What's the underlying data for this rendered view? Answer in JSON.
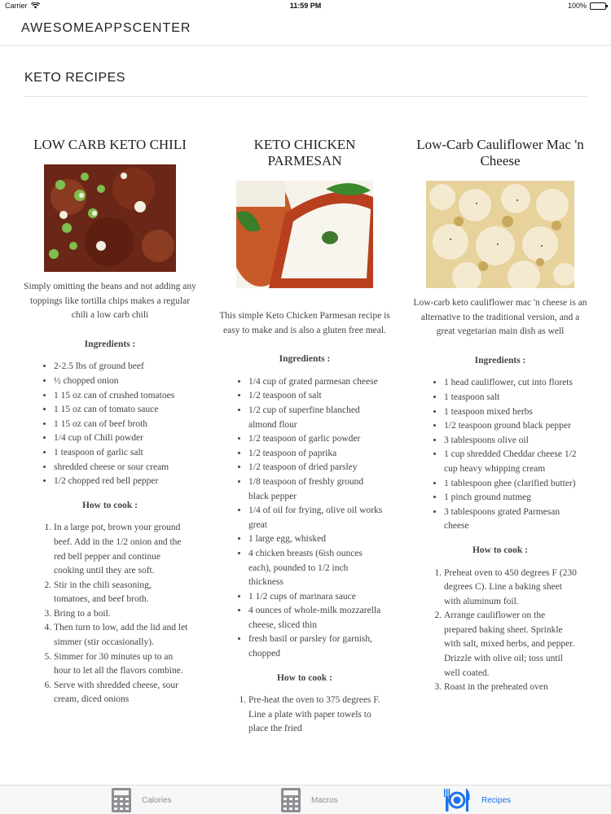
{
  "status_bar": {
    "carrier": "Carrier",
    "time": "11:59 PM",
    "battery": "100%"
  },
  "app": {
    "title": "AWESOMEAPPSCENTER"
  },
  "page": {
    "title": "KETO RECIPES"
  },
  "recipes": [
    {
      "title": "LOW CARB KETO CHILI",
      "description": "Simply omitting the beans and not adding any toppings like tortilla chips makes a regular chili a low carb chili",
      "ingredients_heading": "Ingredients :",
      "ingredients": [
        "2-2.5  lbs of ground beef",
        "½   chopped onion",
        "1  15 oz can of crushed tomatoes",
        "1  15 oz can of tomato sauce",
        "1  15 oz can of beef broth",
        "1/4  cup of Chili powder",
        "1  teaspoon of garlic salt",
        "shredded cheese or sour cream",
        "1/2  chopped red bell pepper"
      ],
      "steps_heading": "How to cook :",
      "steps": [
        "In  a large pot,  brown your ground beef. Add in the 1/2 onion and the  red bell pepper and continue cooking until they are soft.",
        "Stir  in the chili seasoning, tomatoes, and beef broth.",
        "Bring  to a boil.",
        "Then turn to low, add the lid and let simmer (stir occasionally).",
        "Simmer  for 30 minutes up to an hour to let all the flavors combine.",
        "Serve  with shredded cheese, sour cream, diced onions"
      ]
    },
    {
      "title": "KETO CHICKEN PARMESAN",
      "description": "This simple Keto Chicken Parmesan recipe is easy to make and is also a gluten free meal.",
      "ingredients_heading": "Ingredients :",
      "ingredients": [
        "1/4 cup of grated parmesan    cheese",
        "1/2 teaspoon of salt",
        "1/2 cup of superfine blanched    almond flour",
        "1/2 teaspoon of garlic powder",
        "1/2 teaspoon of paprika",
        "1/2 teaspoon of dried parsley",
        "1/8 teaspoon of freshly    ground black pepper",
        "1/4 of oil for frying, olive     oil works great",
        "1 large egg, whisked",
        "4 chicken breasts (6ish    ounces each), pounded to 1/2 inch thickness",
        "1 1/2 cups of marinara sauce",
        "4 ounces of whole-milk    mozzarella cheese, sliced thin",
        "fresh basil or parsley for    garnish, chopped"
      ],
      "steps_heading": "How to cook :",
      "steps": [
        "Pre-heat the oven to 375    degrees F. Line a plate with paper towels to place the fried"
      ]
    },
    {
      "title": "Low-Carb Cauliflower Mac 'n Cheese",
      "description": "Low-carb keto cauliflower mac 'n cheese is an alternative  to the traditional version, and a great vegetarian main dish as well",
      "ingredients_heading": "Ingredients :",
      "ingredients": [
        "1 head cauliflower, cut into florets",
        "1 teaspoon salt",
        "1 teaspoon mixed herbs",
        "1/2 teaspoon ground black pepper",
        "3 tablespoons olive oil",
        "1 cup shredded Cheddar cheese  1/2 cup    heavy whipping cream",
        "1 tablespoon ghee (clarified butter)",
        "1 pinch ground nutmeg",
        "3 tablespoons grated Parmesan cheese"
      ],
      "steps_heading": "How to cook :",
      "steps": [
        "Preheat oven to 450 degrees F (230 degrees   C). Line a baking sheet with aluminum foil.",
        "Arrange cauliflower on the prepared baking   sheet. Sprinkle with salt, mixed herbs, and pepper. Drizzle with olive oil;   toss until well coated.",
        "Roast in the preheated oven"
      ]
    }
  ],
  "tab_bar": {
    "tabs": [
      {
        "label": "Calories",
        "icon": "calculator-icon",
        "active": false
      },
      {
        "label": "Macros",
        "icon": "calculator-icon",
        "active": false
      },
      {
        "label": "Recipes",
        "icon": "utensils-icon",
        "active": true
      }
    ],
    "active_color": "#1a73e8",
    "inactive_color": "#8e8e93"
  }
}
